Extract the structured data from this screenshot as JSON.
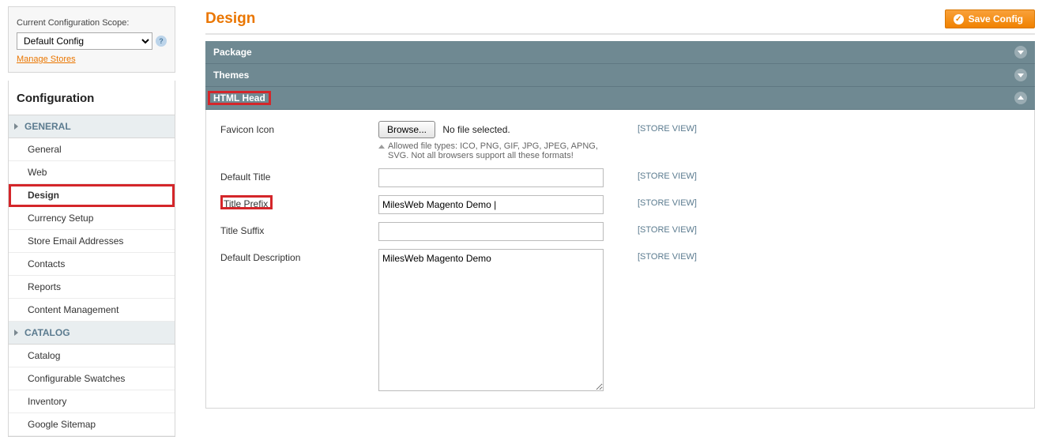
{
  "scope": {
    "label": "Current Configuration Scope:",
    "selected": "Default Config",
    "manage_link": "Manage Stores"
  },
  "sidebar": {
    "title": "Configuration",
    "sections": [
      {
        "label": "GENERAL",
        "items": [
          {
            "label": "General",
            "active": false
          },
          {
            "label": "Web",
            "active": false
          },
          {
            "label": "Design",
            "active": true,
            "highlight": true
          },
          {
            "label": "Currency Setup",
            "active": false
          },
          {
            "label": "Store Email Addresses",
            "active": false
          },
          {
            "label": "Contacts",
            "active": false
          },
          {
            "label": "Reports",
            "active": false
          },
          {
            "label": "Content Management",
            "active": false
          }
        ]
      },
      {
        "label": "CATALOG",
        "items": [
          {
            "label": "Catalog",
            "active": false
          },
          {
            "label": "Configurable Swatches",
            "active": false
          },
          {
            "label": "Inventory",
            "active": false
          },
          {
            "label": "Google Sitemap",
            "active": false
          }
        ]
      }
    ]
  },
  "page": {
    "title": "Design",
    "save_button": "Save Config"
  },
  "accordion": [
    {
      "label": "Package",
      "expanded": false
    },
    {
      "label": "Themes",
      "expanded": false
    },
    {
      "label": "HTML Head",
      "expanded": true,
      "highlight": true
    }
  ],
  "html_head": {
    "fields": {
      "favicon": {
        "label": "Favicon Icon",
        "browse": "Browse...",
        "file_status": "No file selected.",
        "hint": "Allowed file types: ICO, PNG, GIF, JPG, JPEG, APNG, SVG. Not all browsers support all these formats!",
        "scope": "[STORE VIEW]"
      },
      "default_title": {
        "label": "Default Title",
        "value": "",
        "scope": "[STORE VIEW]"
      },
      "title_prefix": {
        "label": "Title Prefix",
        "value": "MilesWeb Magento Demo |",
        "scope": "[STORE VIEW]",
        "highlight": true
      },
      "title_suffix": {
        "label": "Title Suffix",
        "value": "",
        "scope": "[STORE VIEW]"
      },
      "default_description": {
        "label": "Default Description",
        "value": "MilesWeb Magento Demo",
        "scope": "[STORE VIEW]"
      }
    }
  }
}
